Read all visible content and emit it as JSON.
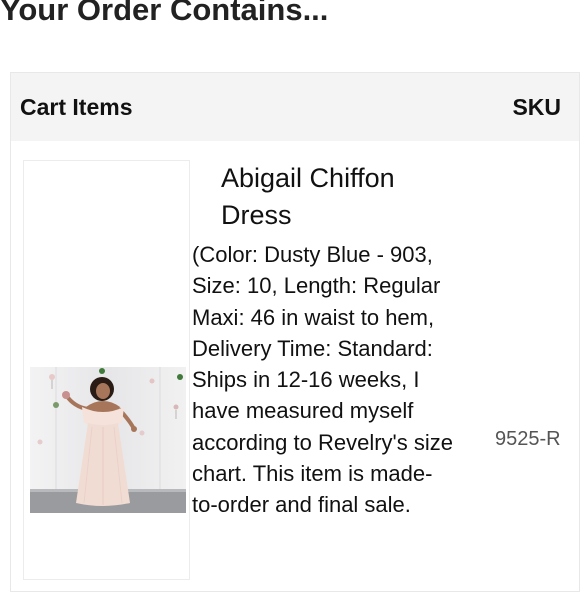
{
  "page": {
    "title": "Your Order Contains..."
  },
  "table": {
    "headers": {
      "items": "Cart Items",
      "sku": "SKU"
    },
    "rows": [
      {
        "name": "Abigail Chiffon Dress",
        "options": "(Color: Dusty Blue - 903, Size: 10, Length: Regular Maxi: 46 in waist to hem, Delivery Time: Standard: Ships in 12-16 weeks, I have measured myself according to Revelry's size chart. This item is made-to-order and final sale.",
        "sku": "9525-R",
        "image": "product-photo-woman-in-off-shoulder-blush-maxi-dress"
      }
    ]
  },
  "colors": {
    "header_bg": "#f4f4f4",
    "sku_text": "#555555",
    "dress": "#f1dcd4",
    "backdrop": "#e9e9ea"
  }
}
